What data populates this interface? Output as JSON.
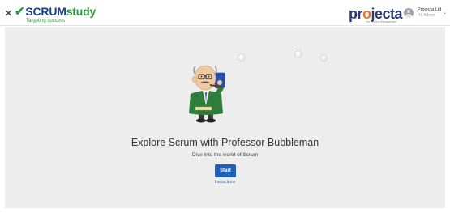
{
  "header": {
    "close_label": "✕",
    "logo": {
      "scrum": "SCRUM",
      "study": "study",
      "tagline": "Targeting success"
    },
    "brand": {
      "pre": "pr",
      "o": "o",
      "post": "jecta",
      "sub": "for Project Management"
    },
    "user": {
      "name": "Projecta Ltd",
      "sub": "Hi, Admin"
    },
    "caret": "⌄"
  },
  "main": {
    "title": "Explore Scrum with Professor Bubbleman",
    "subtitle": "Dive into the world of Scrum",
    "start_label": "Start",
    "instructions_label": "Instructions"
  },
  "colors": {
    "accent_blue": "#1f5fb8",
    "logo_green": "#2b9a3b",
    "stage_bg": "#ededed"
  }
}
